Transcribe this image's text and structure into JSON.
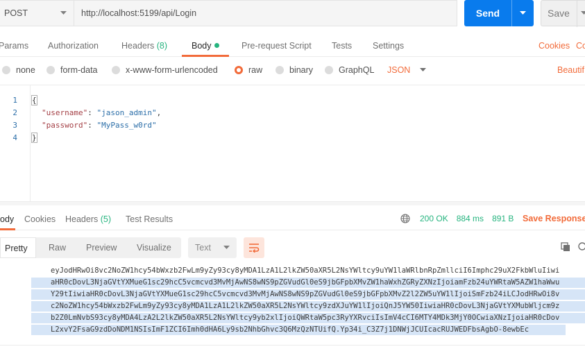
{
  "request": {
    "method": "POST",
    "url": "http://localhost:5199/api/Login",
    "send_label": "Send",
    "save_label": "Save"
  },
  "request_tabs": {
    "params": "Params",
    "authorization": "Authorization",
    "headers": "Headers",
    "headers_count": "(8)",
    "body": "Body",
    "pre_request": "Pre-request Script",
    "tests": "Tests",
    "settings": "Settings",
    "cookies": "Cookies",
    "code": "Co"
  },
  "body_types": {
    "none": "none",
    "form_data": "form-data",
    "urlencoded": "x-www-form-urlencoded",
    "raw": "raw",
    "binary": "binary",
    "graphql": "GraphQL",
    "format": "JSON",
    "beautify": "Beautif"
  },
  "editor": {
    "line_numbers": [
      "1",
      "2",
      "3",
      "4"
    ],
    "open_brace": "{",
    "close_brace": "}",
    "fields": [
      {
        "key": "\"username\"",
        "value": "\"jason_admin\"",
        "trail": ","
      },
      {
        "key": "\"password\"",
        "value": "\"MyPass_w0rd\"",
        "trail": ""
      }
    ]
  },
  "response_tabs": {
    "body": "ody",
    "cookies": "Cookies",
    "headers": "Headers",
    "headers_count": "(5)",
    "test_results": "Test Results"
  },
  "response_status": {
    "status": "200 OK",
    "time": "884 ms",
    "size": "891 B",
    "save_response": "Save Response"
  },
  "view_modes": {
    "pretty": "Pretty",
    "raw": "Raw",
    "preview": "Preview",
    "visualize": "Visualize",
    "text": "Text"
  },
  "token_lines": [
    "eyJodHRwOi8vc2NoZW1hcy54bWxzb2FwLm9yZy93cy8yMDA1LzA1L2lkZW50aXR5L2NsYWltcy9uYW1laWRlbnRpZmllciI6Imphc29uX2FkbWluIiwi",
    "aHR0cDovL3NjaGVtYXMueG1sc29hcC5vcmcvd3MvMjAwNS8wNS9pZGVudGl0eS9jbGFpbXMvZW1haWxhZGRyZXNzIjoiamFzb24uYWRtaW5AZW1haWwu",
    "Y29tIiwiaHR0cDovL3NjaGVtYXMueG1sc29hcC5vcmcvd3MvMjAwNS8wNS9pZGVudGl0eS9jbGFpbXMvZ2l2ZW5uYW1lIjoiSmFzb24iLCJodHRwOi8v",
    "c2NoZW1hcy54bWxzb2FwLm9yZy93cy8yMDA1LzA1L2lkZW50aXR5L2NsYWltcy9zdXJuYW1lIjoiQnJ5YW50IiwiaHR0cDovL3NjaGVtYXMubWljcm9z",
    "b2Z0LmNvbS93cy8yMDA4LzA2L2lkZW50aXR5L2NsYWltcy9yb2xlIjoiQWRtaW5pc3RyYXRvciIsImV4cCI6MTY4MDk3MjY0OCwiaXNzIjoiaHR0cDov",
    "L2xvY2FsaG9zdDoNDM1NSIsImF1ZCI6Imh0dHA6Ly9sb2NhbGhvc3Q6MzQzNTUifQ.Yp34i_C3Z7j1DNWjJCUIcacRUJWEDFbsAgbO-8ewbEc"
  ]
}
